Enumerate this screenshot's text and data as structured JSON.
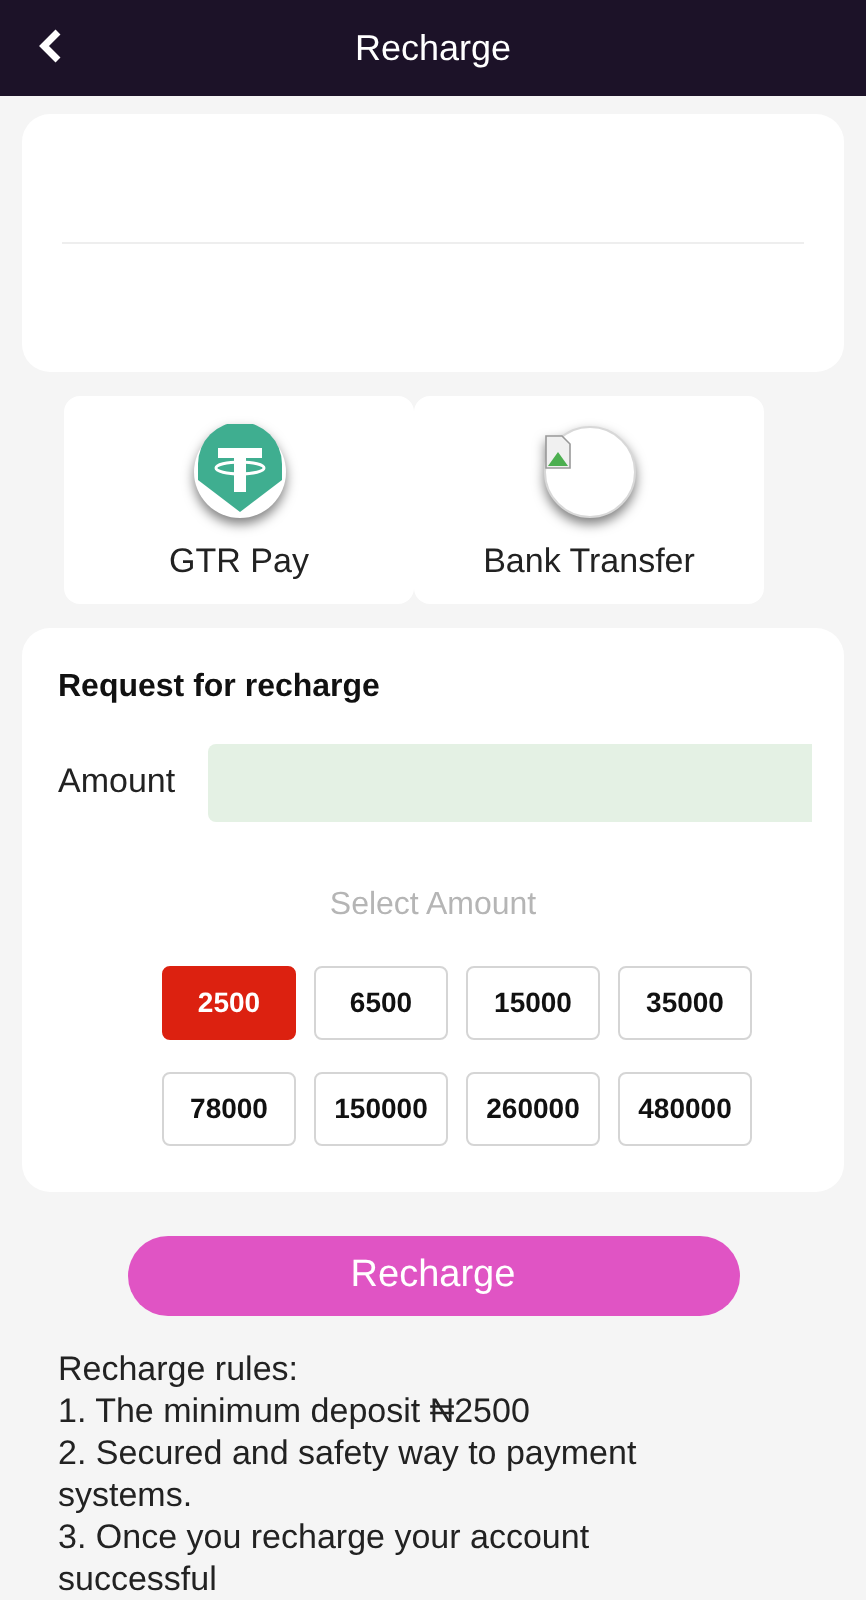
{
  "header": {
    "title": "Recharge"
  },
  "payment_methods": [
    {
      "kind": "tether",
      "label": "GTR Pay"
    },
    {
      "kind": "broken-image",
      "label": "Bank Transfer"
    }
  ],
  "request": {
    "title": "Request for recharge",
    "amount_label": "Amount",
    "select_label": "Select Amount",
    "amounts": [
      {
        "label": "2500",
        "selected": true
      },
      {
        "label": "6500",
        "selected": false
      },
      {
        "label": "15000",
        "selected": false
      },
      {
        "label": "35000",
        "selected": false
      },
      {
        "label": "78000",
        "selected": false
      },
      {
        "label": "150000",
        "selected": false
      },
      {
        "label": "260000",
        "selected": false
      },
      {
        "label": "480000",
        "selected": false
      }
    ]
  },
  "submit_button": "Recharge",
  "rules": [
    "Recharge rules:",
    "1. The minimum deposit ₦2500",
    "2. Secured and safety way to payment systems.",
    "3. Once you recharge your account successful"
  ]
}
